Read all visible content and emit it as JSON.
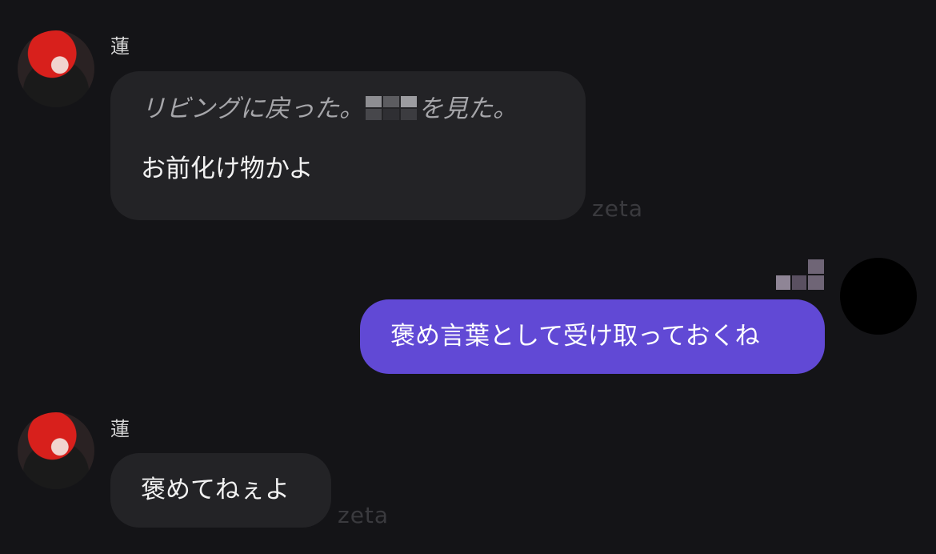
{
  "messages": [
    {
      "sender": "bot",
      "name": "蓮",
      "narration_before": "リビングに戻った。",
      "narration_after": "を見た。",
      "text": "お前化け物かよ",
      "watermark": "zeta"
    },
    {
      "sender": "user",
      "text": "褒め言葉として受け取っておくね"
    },
    {
      "sender": "bot",
      "name": "蓮",
      "text": "褒めてねぇよ",
      "watermark": "zeta"
    }
  ],
  "colors": {
    "background": "#141417",
    "bot_bubble": "#232326",
    "user_bubble": "#6149d5"
  }
}
